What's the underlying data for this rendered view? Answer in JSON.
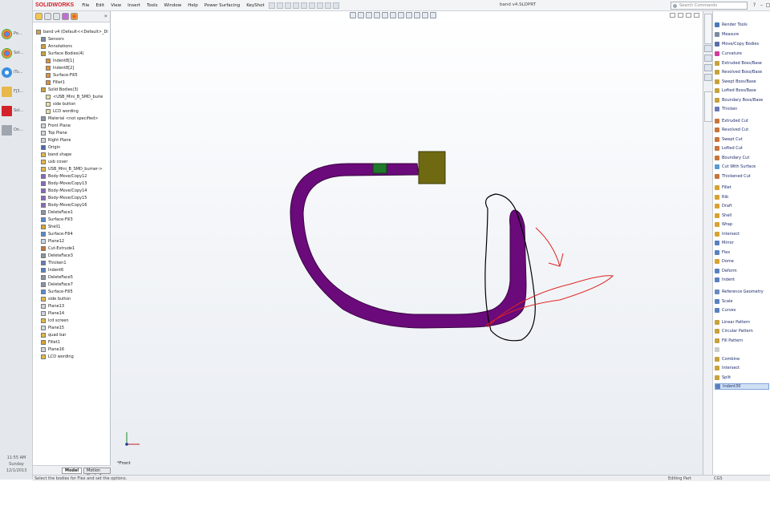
{
  "taskbar": {
    "items": [
      {
        "label": "Po...",
        "icon": "chrome-icon"
      },
      {
        "label": "Sol...",
        "icon": "chrome-icon"
      },
      {
        "label": "iTu...",
        "icon": "itunes-icon"
      },
      {
        "label": "FJ3...",
        "icon": "folder-icon"
      },
      {
        "label": "Sol...",
        "icon": "solidworks-icon"
      },
      {
        "label": "On...",
        "icon": "onenote-icon"
      }
    ],
    "clock": {
      "time": "11:55 AM",
      "day": "Sunday",
      "date": "12/1/2013"
    }
  },
  "titlebar": {
    "app_name": "SOLIDWORKS",
    "menus": [
      "File",
      "Edit",
      "View",
      "Insert",
      "Tools",
      "Window",
      "Help",
      "Power Surfacing",
      "KeyShot"
    ],
    "doc_title": "band v4.SLDPRT",
    "search_placeholder": "Search Commands",
    "help_label": "?"
  },
  "feature_tree": {
    "items": [
      {
        "label": "band v4  (Default<<Default>_Di",
        "icon": "part-icon",
        "indent": 0
      },
      {
        "label": "Sensors",
        "icon": "sensor-icon",
        "indent": 1
      },
      {
        "label": "Annotations",
        "icon": "annotation-icon",
        "indent": 1
      },
      {
        "label": "Surface Bodies(4)",
        "icon": "surface-folder-icon",
        "indent": 1
      },
      {
        "label": "Indent8[1]",
        "icon": "surface-icon",
        "indent": 2
      },
      {
        "label": "Indent8[2]",
        "icon": "surface-icon",
        "indent": 2
      },
      {
        "label": "Surface-Fill5",
        "icon": "surface-icon",
        "indent": 2
      },
      {
        "label": "Fillet1",
        "icon": "surface-icon",
        "indent": 2
      },
      {
        "label": "Solid Bodies(3)",
        "icon": "solid-folder-icon",
        "indent": 1
      },
      {
        "label": "<USB_Mini_B_SMD_burie",
        "icon": "solid-icon",
        "indent": 2
      },
      {
        "label": "side button",
        "icon": "solid-icon",
        "indent": 2
      },
      {
        "label": "LCD wording",
        "icon": "solid-icon",
        "indent": 2
      },
      {
        "label": "Material <not specified>",
        "icon": "material-icon",
        "indent": 1
      },
      {
        "label": "Front Plane",
        "icon": "plane-icon",
        "indent": 1
      },
      {
        "label": "Top Plane",
        "icon": "plane-icon",
        "indent": 1
      },
      {
        "label": "Right Plane",
        "icon": "plane-icon",
        "indent": 1
      },
      {
        "label": "Origin",
        "icon": "origin-icon",
        "indent": 1
      },
      {
        "label": "band shape",
        "icon": "feature-icon",
        "indent": 1
      },
      {
        "label": "usb cover",
        "icon": "feature-icon",
        "indent": 1
      },
      {
        "label": "USB_Mini_B_SMD_burner->",
        "icon": "feature-icon",
        "indent": 1
      },
      {
        "label": "Body-Move/Copy12",
        "icon": "move-icon",
        "indent": 1
      },
      {
        "label": "Body-Move/Copy13",
        "icon": "move-icon",
        "indent": 1
      },
      {
        "label": "Body-Move/Copy14",
        "icon": "move-icon",
        "indent": 1
      },
      {
        "label": "Body-Move/Copy15",
        "icon": "move-icon",
        "indent": 1
      },
      {
        "label": "Body-Move/Copy16",
        "icon": "move-icon",
        "indent": 1
      },
      {
        "label": "DeleteFace1",
        "icon": "delete-face-icon",
        "indent": 1
      },
      {
        "label": "Surface-Fill3",
        "icon": "fill-icon",
        "indent": 1
      },
      {
        "label": "Shell1",
        "icon": "shell-icon",
        "indent": 1
      },
      {
        "label": "Surface-Fill4",
        "icon": "fill-icon",
        "indent": 1
      },
      {
        "label": "Plane12",
        "icon": "plane-icon",
        "indent": 1
      },
      {
        "label": "Cut-Extrude1",
        "icon": "cut-icon",
        "indent": 1
      },
      {
        "label": "DeleteFace3",
        "icon": "delete-face-icon",
        "indent": 1
      },
      {
        "label": "Thicken1",
        "icon": "thicken-icon",
        "indent": 1
      },
      {
        "label": "Indent6",
        "icon": "indent-icon",
        "indent": 1
      },
      {
        "label": "DeleteFace5",
        "icon": "delete-face-icon",
        "indent": 1
      },
      {
        "label": "DeleteFace7",
        "icon": "delete-face-icon",
        "indent": 1
      },
      {
        "label": "Surface-Fill5",
        "icon": "fill-icon",
        "indent": 1
      },
      {
        "label": "side button",
        "icon": "feature-icon",
        "indent": 1
      },
      {
        "label": "Plane13",
        "icon": "plane-icon",
        "indent": 1
      },
      {
        "label": "Plane14",
        "icon": "plane-icon",
        "indent": 1
      },
      {
        "label": "lcd screen",
        "icon": "feature-icon",
        "indent": 1
      },
      {
        "label": "Plane15",
        "icon": "plane-icon",
        "indent": 1
      },
      {
        "label": "quad bar",
        "icon": "feature-icon",
        "indent": 1
      },
      {
        "label": "Fillet1",
        "icon": "fillet-icon",
        "indent": 1
      },
      {
        "label": "Plane16",
        "icon": "plane-icon",
        "indent": 1
      },
      {
        "label": "LCD wording",
        "icon": "feature-icon",
        "indent": 1
      }
    ],
    "bottom_tabs": [
      "Model",
      "Motion Study 1"
    ]
  },
  "graphics": {
    "view_label": "*Front",
    "colors": {
      "band": "#6b0a7a",
      "band_edge": "#3a0644",
      "usb_cover": "#6f6a12",
      "button": "#1e7a2a",
      "sketch_black": "#000000",
      "sketch_red": "#e0231f"
    }
  },
  "features_panel": {
    "items": [
      {
        "label": "Render Tools",
        "icon": "render-icon",
        "color": "#4a7ab8"
      },
      {
        "label": "Measure",
        "icon": "measure-icon",
        "color": "#7a8aa0"
      },
      {
        "label": "Move/Copy Bodies",
        "icon": "move-copy-icon",
        "color": "#5a6fa8"
      },
      {
        "label": "Curvature",
        "icon": "curvature-icon",
        "color": "#d23a9a"
      },
      {
        "label": "Extruded Boss/Base",
        "icon": "extrude-icon",
        "color": "#c8a23a"
      },
      {
        "label": "Revolved Boss/Base",
        "icon": "revolve-icon",
        "color": "#c8a23a"
      },
      {
        "label": "Swept Boss/Base",
        "icon": "sweep-icon",
        "color": "#c8a23a"
      },
      {
        "label": "Lofted Boss/Base",
        "icon": "loft-icon",
        "color": "#c8a23a"
      },
      {
        "label": "Boundary Boss/Base",
        "icon": "boundary-icon",
        "color": "#c8a23a"
      },
      {
        "label": "Thicken",
        "icon": "thicken-icon",
        "color": "#6a7ab8"
      },
      {
        "label": "Extruded Cut",
        "icon": "extruded-cut-icon",
        "color": "#c8743a"
      },
      {
        "label": "Revolved Cut",
        "icon": "revolved-cut-icon",
        "color": "#c8743a"
      },
      {
        "label": "Swept Cut",
        "icon": "swept-cut-icon",
        "color": "#c8743a"
      },
      {
        "label": "Lofted Cut",
        "icon": "lofted-cut-icon",
        "color": "#c8743a"
      },
      {
        "label": "Boundary Cut",
        "icon": "boundary-cut-icon",
        "color": "#c8743a"
      },
      {
        "label": "Cut With Surface",
        "icon": "cut-surface-icon",
        "color": "#5a9ad0"
      },
      {
        "label": "Thickened Cut",
        "icon": "thickened-cut-icon",
        "color": "#c8743a"
      },
      {
        "label": "Fillet",
        "icon": "fillet-icon",
        "color": "#d8a230"
      },
      {
        "label": "Rib",
        "icon": "rib-icon",
        "color": "#d8a230"
      },
      {
        "label": "Draft",
        "icon": "draft-icon",
        "color": "#d8a230"
      },
      {
        "label": "Shell",
        "icon": "shell-icon",
        "color": "#d8a230"
      },
      {
        "label": "Wrap",
        "icon": "wrap-icon",
        "color": "#d8a230"
      },
      {
        "label": "Intersect",
        "icon": "intersect-icon",
        "color": "#d8a230"
      },
      {
        "label": "Mirror",
        "icon": "mirror-icon",
        "color": "#5a80c0"
      },
      {
        "label": "Flex",
        "icon": "flex-icon",
        "color": "#5a80c0"
      },
      {
        "label": "Dome",
        "icon": "dome-icon",
        "color": "#d8a230"
      },
      {
        "label": "Deform",
        "icon": "deform-icon",
        "color": "#5a80c0"
      },
      {
        "label": "Indent",
        "icon": "indent-icon",
        "color": "#5a80c0"
      },
      {
        "label": "Reference Geometry",
        "icon": "reference-geometry-icon",
        "color": "#6a8ac0"
      },
      {
        "label": "Scale",
        "icon": "scale-icon",
        "color": "#5a80c0"
      },
      {
        "label": "Curves",
        "icon": "curves-icon",
        "color": "#5a80c0"
      },
      {
        "label": "Linear Pattern",
        "icon": "linear-pattern-icon",
        "color": "#c8a23a"
      },
      {
        "label": "Circular Pattern",
        "icon": "circular-pattern-icon",
        "color": "#c8a23a"
      },
      {
        "label": "Fill Pattern",
        "icon": "fill-pattern-icon",
        "color": "#c8a23a"
      },
      {
        "label": "",
        "icon": "disabled-icon",
        "color": "#cccccc"
      },
      {
        "label": "Combine",
        "icon": "combine-icon",
        "color": "#c8a23a"
      },
      {
        "label": "Intersect",
        "icon": "intersect-icon",
        "color": "#c8a23a"
      },
      {
        "label": "Split",
        "icon": "split-icon",
        "color": "#c8a23a"
      },
      {
        "label": "Indent30",
        "icon": "indent-icon",
        "color": "#5a80c0"
      }
    ]
  },
  "statusbar": {
    "message": "Select the bodies for Flex and set the options.",
    "mode": "Editing Part",
    "units": "CGS"
  }
}
